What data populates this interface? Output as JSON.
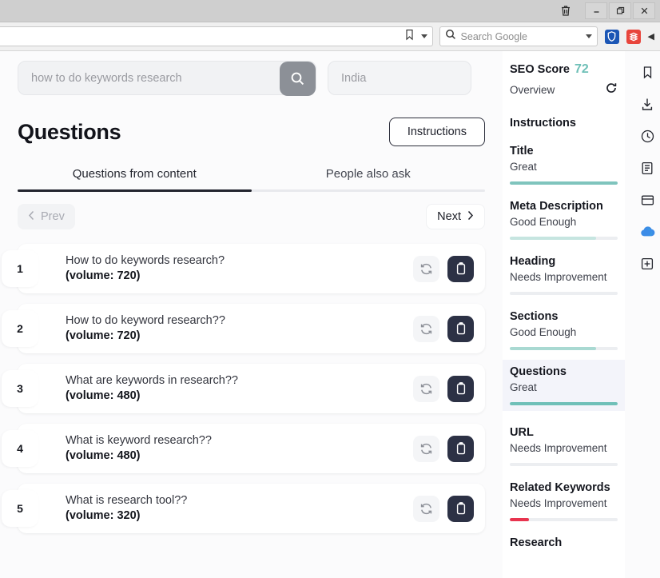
{
  "window": {
    "buttons": [
      {
        "name": "trash-icon",
        "label": "🗑"
      },
      {
        "name": "minimize-button",
        "label": "–"
      },
      {
        "name": "restore-button",
        "label": "❐"
      },
      {
        "name": "close-button",
        "label": "✕"
      }
    ]
  },
  "browser": {
    "url_value": "",
    "bookmark_icon": "bookmark-icon",
    "search": {
      "placeholder": "Search Google",
      "icon": "search-icon"
    },
    "extensions": [
      {
        "name": "shield-extension-icon",
        "color": "#1b56b5"
      },
      {
        "name": "red-extension-icon",
        "color": "#e8453c"
      }
    ],
    "collapse_label": "◀"
  },
  "search_bar": {
    "keyword_value": "how to do keywords research",
    "keyword_placeholder": "how to do keywords research",
    "location_value": "India",
    "location_placeholder": "India",
    "search_button_icon": "search-icon"
  },
  "header": {
    "title": "Questions",
    "instructions_label": "Instructions"
  },
  "tabs": [
    {
      "label": "Questions from content",
      "active": true
    },
    {
      "label": "People also ask",
      "active": false
    }
  ],
  "pager": {
    "prev_label": "Prev",
    "next_label": "Next",
    "prev_icon": "chevron-left-icon",
    "next_icon": "chevron-right-icon"
  },
  "questions": [
    {
      "num": "1",
      "question": "How to do keywords research?",
      "volume": "(volume: 720)"
    },
    {
      "num": "2",
      "question": "How to do keyword research??",
      "volume": "(volume: 720)"
    },
    {
      "num": "3",
      "question": "What are keywords in research??",
      "volume": "(volume: 480)"
    },
    {
      "num": "4",
      "question": "What is keyword research??",
      "volume": "(volume: 480)"
    },
    {
      "num": "5",
      "question": "What is research tool??",
      "volume": "(volume: 320)"
    }
  ],
  "row_actions": {
    "refresh_icon": "refresh-icon",
    "copy_icon": "clipboard-icon"
  },
  "seo": {
    "score_label": "SEO Score",
    "score_value": "72",
    "score_color": "#6fc0b8",
    "overview_label": "Overview",
    "refresh_icon": "refresh-circle-icon",
    "section_title": "Instructions",
    "items": [
      {
        "name": "Title",
        "status": "Great",
        "pct": 100,
        "color": "#7fc4bd"
      },
      {
        "name": "Meta Description",
        "status": "Good Enough",
        "pct": 80,
        "color": "#c6e5e0"
      },
      {
        "name": "Heading",
        "status": "Needs Improvement",
        "pct": 0,
        "color": "#e8eaee"
      },
      {
        "name": "Sections",
        "status": "Good Enough",
        "pct": 80,
        "color": "#a9d9d2"
      },
      {
        "name": "Questions",
        "status": "Great",
        "pct": 100,
        "color": "#6fc0b8",
        "active": true
      },
      {
        "name": "URL",
        "status": "Needs Improvement",
        "pct": 0,
        "color": "#e8eaee"
      },
      {
        "name": "Related Keywords",
        "status": "Needs Improvement",
        "pct": 18,
        "color": "#e8344f"
      },
      {
        "name": "Research",
        "status": "",
        "pct": 0,
        "color": "#e8eaee"
      }
    ]
  },
  "rail": {
    "icons": [
      "bookmark-icon",
      "download-icon",
      "history-clock-icon",
      "reading-list-icon",
      "wallet-icon",
      "cloud-drive-icon",
      "add-tab-icon"
    ]
  }
}
